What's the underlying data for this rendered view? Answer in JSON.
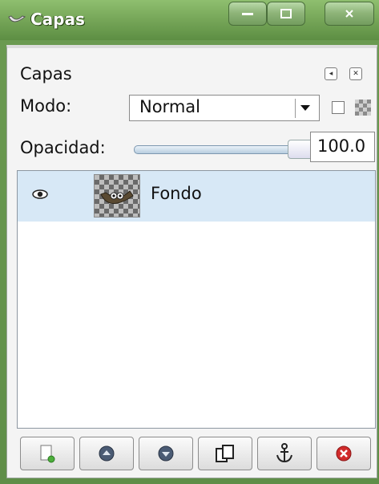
{
  "window": {
    "title": "Capas",
    "icon": "gimp-dock-icon",
    "controls": [
      "minimize",
      "maximize",
      "close"
    ]
  },
  "panel": {
    "title": "Capas",
    "menu_icon": "panel-menu-icon",
    "close_icon": "panel-close-icon"
  },
  "mode": {
    "label": "Modo:",
    "value": "Normal",
    "lock_checkbox_checked": false
  },
  "opacity": {
    "label": "Opacidad:",
    "value": "100.0",
    "fraction": 1.0
  },
  "layers": [
    {
      "name": "Fondo",
      "visible": true,
      "selected": true,
      "thumbnail": "wilber-thumbnail"
    }
  ],
  "toolbar": {
    "buttons": [
      {
        "name": "new-layer-button",
        "icon": "new-layer-icon"
      },
      {
        "name": "raise-layer-button",
        "icon": "raise-icon"
      },
      {
        "name": "lower-layer-button",
        "icon": "lower-icon"
      },
      {
        "name": "duplicate-layer-button",
        "icon": "duplicate-icon"
      },
      {
        "name": "anchor-layer-button",
        "icon": "anchor-icon"
      },
      {
        "name": "delete-layer-button",
        "icon": "delete-icon"
      }
    ]
  },
  "colors": {
    "titlebar": "#6b9a51",
    "selection": "#d7e8f6",
    "delete_red": "#d12b2b"
  }
}
